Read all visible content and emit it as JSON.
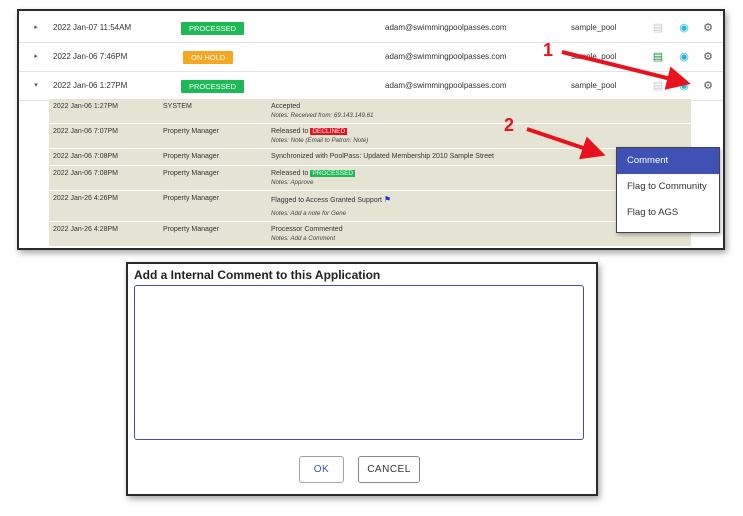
{
  "rows": [
    {
      "date": "2022 Jan-07 11:54AM",
      "status": "PROCESSED",
      "status_color": "#1db954",
      "email": "adam@swimmingpoolpasses.com",
      "pool": "sample_pool",
      "expand": "▸"
    },
    {
      "date": "2022 Jan-06 7:46PM",
      "status": "ON HOLD",
      "status_color": "#f5a623",
      "email": "adam@swimmingpoolpasses.com",
      "pool": "sample_pool",
      "expand": "▸"
    },
    {
      "date": "2022 Jan-06 1:27PM",
      "status": "PROCESSED",
      "status_color": "#1db954",
      "email": "adam@swimmingpoolpasses.com",
      "pool": "sample_pool",
      "expand": "▾"
    }
  ],
  "history": [
    {
      "date": "2022 Jan-06 1:27PM",
      "user": "SYSTEM",
      "desc": "Accepted",
      "notes": "Notes: Received from: 69.143.149.61"
    },
    {
      "date": "2022 Jan-06 7:07PM",
      "user": "Property Manager",
      "desc": "Released to",
      "badge": "DECLINED",
      "badge_color": "#e8121e",
      "notes": "Notes: Note (Email to Patron: Note)"
    },
    {
      "date": "2022 Jan-06 7:08PM",
      "user": "Property Manager",
      "desc": "Synchronized with PoolPass: Updated Membership 2010 Sample Street",
      "notes": ""
    },
    {
      "date": "2022 Jan-06 7:08PM",
      "user": "Property Manager",
      "desc": "Released to",
      "badge": "PROCESSED",
      "badge_color": "#1db954",
      "notes": "Notes: Approve"
    },
    {
      "date": "2022 Jan-26 4:26PM",
      "user": "Property Manager",
      "desc": "Flagged to Access Granted Support",
      "flag": true,
      "notes": "Notes: Add a note for Gene"
    },
    {
      "date": "2022 Jan-26 4:28PM",
      "user": "Property Manager",
      "desc": "Processor Commented",
      "notes": "Notes: Add a Comment"
    }
  ],
  "menu": {
    "items": [
      "Comment",
      "Flag to Community",
      "Flag to AGS"
    ]
  },
  "callouts": {
    "one": "1",
    "two": "2"
  },
  "dialog": {
    "title": "Add a Internal Comment to this Application",
    "value": "",
    "ok": "OK",
    "cancel": "CANCEL"
  },
  "colors": {
    "accent": "#3f51b5",
    "arrow": "#e8121e",
    "eye": "#29b6d8",
    "clipboard_active": "#1b8a3a"
  }
}
